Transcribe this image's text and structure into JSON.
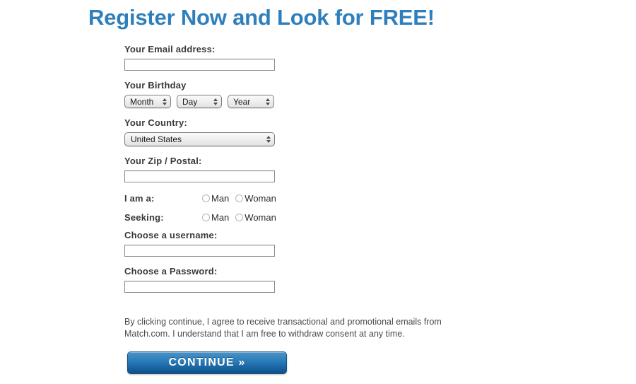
{
  "headline": "Register Now and Look for FREE!",
  "form": {
    "email": {
      "label": "Your Email address:",
      "value": "",
      "placeholder": ""
    },
    "birthday": {
      "label": "Your Birthday",
      "month": {
        "value": "Month"
      },
      "day": {
        "value": "Day"
      },
      "year": {
        "value": "Year"
      }
    },
    "country": {
      "label": "Your Country:",
      "value": "United States"
    },
    "zip": {
      "label": "Your Zip / Postal:",
      "value": "",
      "placeholder": ""
    },
    "i_am_a": {
      "label": "I am a:",
      "options": [
        {
          "label": "Man",
          "selected": false
        },
        {
          "label": "Woman",
          "selected": false
        }
      ]
    },
    "seeking": {
      "label": "Seeking:",
      "options": [
        {
          "label": "Man",
          "selected": false
        },
        {
          "label": "Woman",
          "selected": false
        }
      ]
    },
    "username": {
      "label": "Choose a username:",
      "value": "",
      "placeholder": ""
    },
    "password": {
      "label": "Choose a Password:",
      "value": "",
      "placeholder": ""
    }
  },
  "consent_text": "By clicking continue, I agree to receive transactional and promotional emails from Match.com. I understand that I am free to withdraw consent at any time.",
  "continue_label": "CONTINUE »",
  "colors": {
    "headline": "#2f7fbc",
    "button_top": "#4a92c6",
    "button_bottom": "#0f4e87",
    "label_text": "#3a3a3a",
    "consent_text": "#4a4a4a",
    "input_border": "#8c8c8c"
  }
}
